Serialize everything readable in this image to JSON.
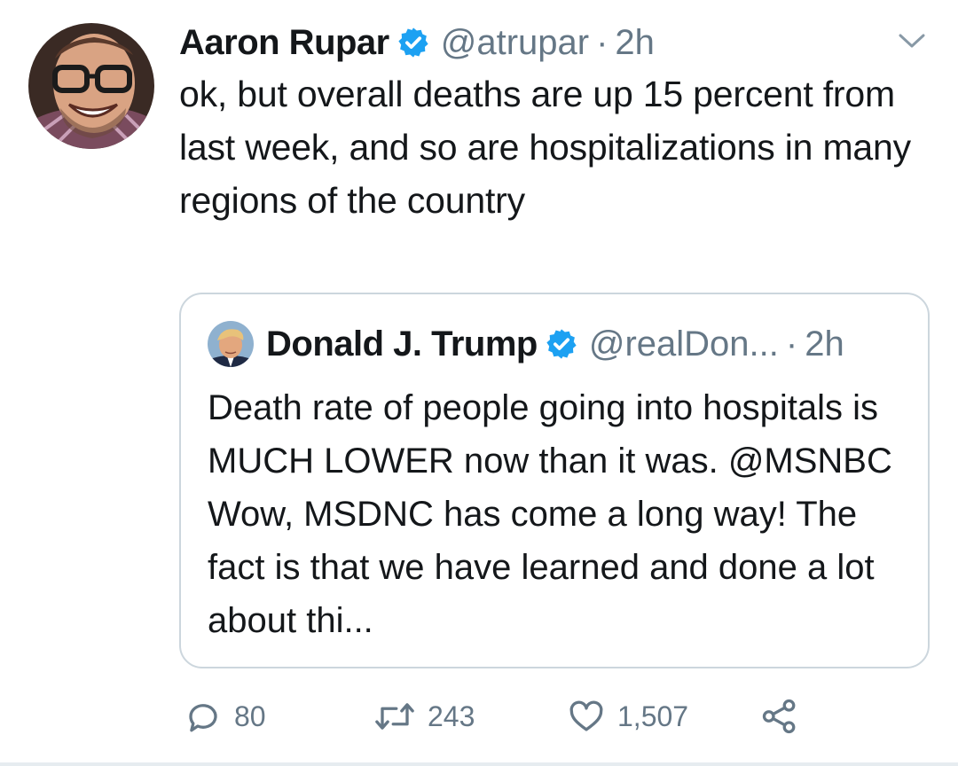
{
  "tweet": {
    "author": {
      "name": "Aaron Rupar",
      "handle": "@atrupar",
      "verified": true,
      "avatar": "author-avatar"
    },
    "separator": "·",
    "time": "2h",
    "menu_icon": "chevron-down-icon",
    "text": "ok, but overall deaths are up 15 percent from last week, and so are hospitalizations in many regions of the country"
  },
  "quoted_tweet": {
    "author": {
      "name": "Donald J. Trump",
      "handle": "@realDon...",
      "verified": true,
      "avatar": "quoted-author-avatar"
    },
    "separator": "·",
    "time": "2h",
    "text": "Death rate of people going into hospitals is MUCH LOWER now than it was. @MSNBC  Wow, MSDNC has come a long way! The fact is that we have learned and done a lot about thi..."
  },
  "actions": {
    "reply": {
      "icon": "reply-icon",
      "count": "80"
    },
    "retweet": {
      "icon": "retweet-icon",
      "count": "243"
    },
    "like": {
      "icon": "heart-icon",
      "count": "1,507"
    },
    "share": {
      "icon": "share-icon"
    }
  },
  "colors": {
    "text": "#14171a",
    "secondary": "#657786",
    "verified": "#1da1f2",
    "border": "#ccd6dd"
  }
}
